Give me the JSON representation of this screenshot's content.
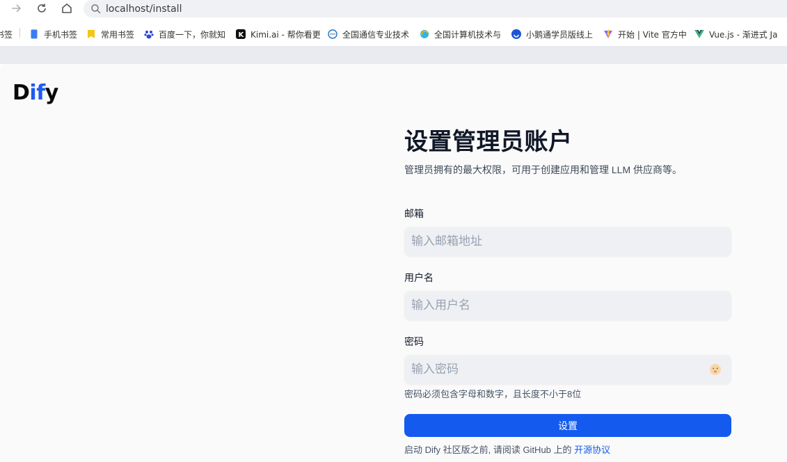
{
  "browser": {
    "url": "localhost/install",
    "bookmarks": [
      {
        "label": "书签",
        "icon": "folder-icon"
      },
      {
        "label": "手机书签",
        "icon": "phone-icon"
      },
      {
        "label": "常用书签",
        "icon": "bookmark-icon"
      },
      {
        "label": "百度一下，你就知",
        "icon": "baidu-icon"
      },
      {
        "label": "Kimi.ai - 帮你看更",
        "icon": "kimi-icon"
      },
      {
        "label": "全国通信专业技术",
        "icon": "globe-icon"
      },
      {
        "label": "全国计算机技术与",
        "icon": "edge-icon"
      },
      {
        "label": "小鹅通学员版线上",
        "icon": "xiaoe-icon"
      },
      {
        "label": "开始 | Vite 官方中",
        "icon": "vite-icon"
      },
      {
        "label": "Vue.js - 渐进式 Ja",
        "icon": "vue-icon"
      }
    ]
  },
  "app": {
    "logo": {
      "part1": "D",
      "part2": "if",
      "part3": "y"
    }
  },
  "form": {
    "title": "设置管理员账户",
    "subtitle": "管理员拥有的最大权限，可用于创建应用和管理 LLM 供应商等。",
    "email": {
      "label": "邮箱",
      "placeholder": "输入邮箱地址",
      "value": ""
    },
    "username": {
      "label": "用户名",
      "placeholder": "输入用户名",
      "value": ""
    },
    "password": {
      "label": "密码",
      "placeholder": "输入密码",
      "value": "",
      "hint": "密码必须包含字母和数字，且长度不小于8位"
    },
    "submit_label": "设置",
    "terms_prefix": "启动 Dify 社区版之前, 请阅读 GitHub 上的 ",
    "terms_link": "开源协议"
  },
  "colors": {
    "accent": "#155aef",
    "logo_blue": "#1f5bf0"
  }
}
